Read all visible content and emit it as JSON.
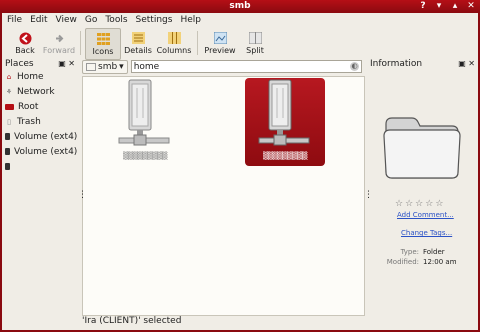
{
  "window": {
    "title": "smb"
  },
  "menu": [
    "File",
    "Edit",
    "View",
    "Go",
    "Tools",
    "Settings",
    "Help"
  ],
  "toolbar": {
    "back": "Back",
    "forward": "Forward",
    "icons": "Icons",
    "details": "Details",
    "columns": "Columns",
    "preview": "Preview",
    "split": "Split"
  },
  "places": {
    "title": "Places",
    "items": [
      {
        "label": "Home",
        "icon": "home-icon"
      },
      {
        "label": "Network",
        "icon": "network-icon"
      },
      {
        "label": "Root",
        "icon": "root-icon"
      },
      {
        "label": "Trash",
        "icon": "trash-icon"
      },
      {
        "label": "Volume (ext4)",
        "icon": "drive-icon"
      },
      {
        "label": "Volume (ext4)",
        "icon": "drive-icon"
      },
      {
        "label": "",
        "icon": "drive-icon"
      }
    ]
  },
  "location": {
    "crumb": "smb",
    "path": "home"
  },
  "status": "'Ira (CLIENT)' selected",
  "info": {
    "title": "Information",
    "add_comment": "Add Comment...",
    "change_tags": "Change Tags...",
    "type_key": "Type:",
    "type_val": "Folder",
    "modified_key": "Modified:",
    "modified_val": "12:00 am"
  },
  "colors": {
    "accent": "#b50f16"
  }
}
